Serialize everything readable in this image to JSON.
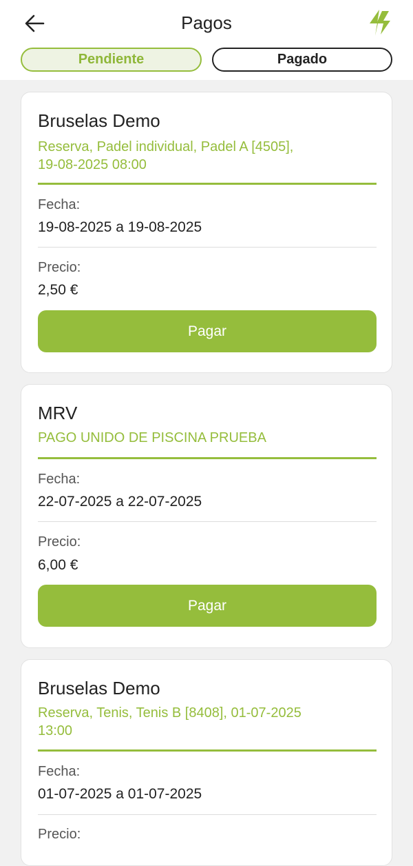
{
  "header": {
    "title": "Pagos",
    "back_icon": "arrow-left-icon",
    "logo_icon": "lightning-logo-icon",
    "accent": "#95bd3c"
  },
  "tabs": [
    {
      "label": "Pendiente",
      "active": true
    },
    {
      "label": "Pagado",
      "active": false
    }
  ],
  "payments": [
    {
      "club": "Bruselas Demo",
      "desc_line1": "Reserva, Padel individual, Padel A [4505],",
      "desc_line2": "19-08-2025 08:00",
      "fecha_label": "Fecha:",
      "fecha": "19-08-2025 a 19-08-2025",
      "precio_label": "Precio:",
      "precio": "2,50 €",
      "button": "Pagar"
    },
    {
      "club": "MRV",
      "desc_line1": "PAGO UNIDO DE PISCINA PRUEBA",
      "fecha_label": "Fecha:",
      "fecha": "22-07-2025 a 22-07-2025",
      "precio_label": "Precio:",
      "precio": "6,00 €",
      "button": "Pagar"
    },
    {
      "club": "Bruselas Demo",
      "desc_line1": "Reserva, Tenis, Tenis B [8408], 01-07-2025",
      "desc_line2": "13:00",
      "fecha_label": "Fecha:",
      "fecha": "01-07-2025 a 01-07-2025",
      "precio_label": "Precio:"
    }
  ]
}
